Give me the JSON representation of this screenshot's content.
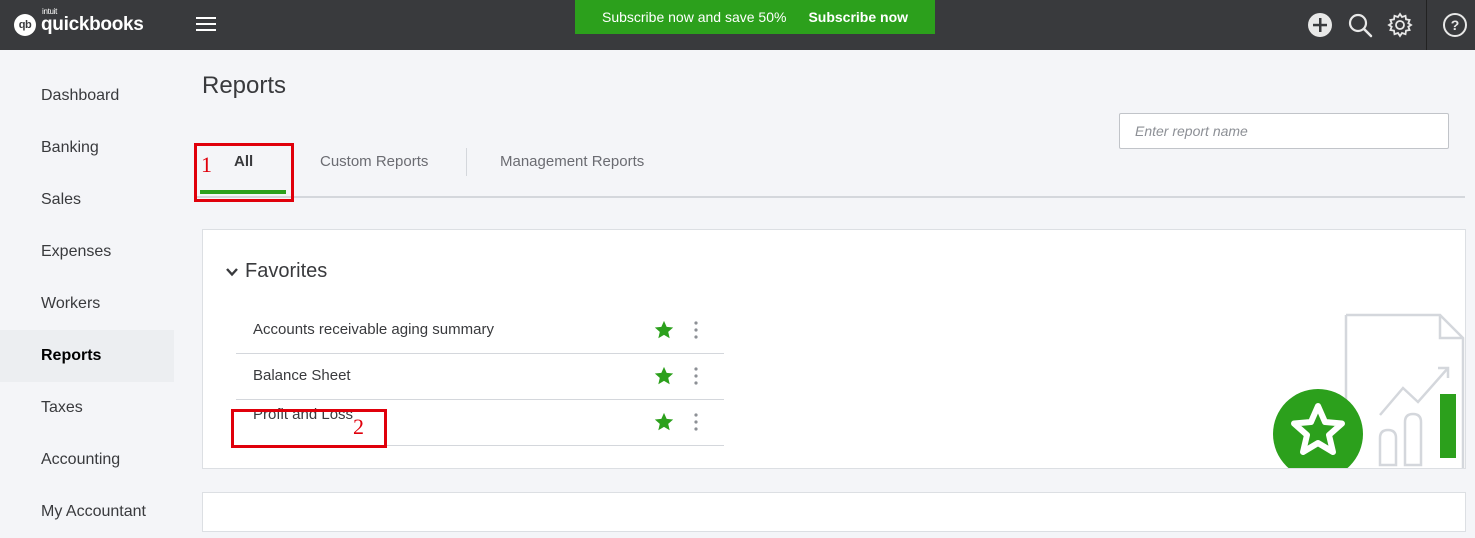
{
  "header": {
    "logo_brand": "quickbooks",
    "logo_intuit": "intuit",
    "logo_mark": "qb",
    "promo_text": "Subscribe now and save 50%",
    "promo_button": "Subscribe now",
    "icons": [
      "plus-circle-icon",
      "search-icon",
      "gear-icon",
      "help-icon"
    ]
  },
  "sidebar": {
    "items": [
      {
        "label": "Dashboard"
      },
      {
        "label": "Banking"
      },
      {
        "label": "Sales"
      },
      {
        "label": "Expenses"
      },
      {
        "label": "Workers"
      },
      {
        "label": "Reports",
        "active": true
      },
      {
        "label": "Taxes"
      },
      {
        "label": "Accounting"
      },
      {
        "label": "My Accountant"
      }
    ]
  },
  "main": {
    "title": "Reports",
    "search_placeholder": "Enter report name",
    "tabs": [
      {
        "label": "All",
        "active": true
      },
      {
        "label": "Custom Reports"
      },
      {
        "label": "Management Reports"
      }
    ],
    "favorites": {
      "title": "Favorites",
      "reports": [
        {
          "name": "Accounts receivable aging summary"
        },
        {
          "name": "Balance Sheet"
        },
        {
          "name": "Profit and Loss"
        }
      ]
    }
  },
  "annotations": [
    "1",
    "2"
  ],
  "colors": {
    "topbar": "#393a3d",
    "accent_green": "#2ca01c",
    "annotation_red": "#e0000b"
  }
}
